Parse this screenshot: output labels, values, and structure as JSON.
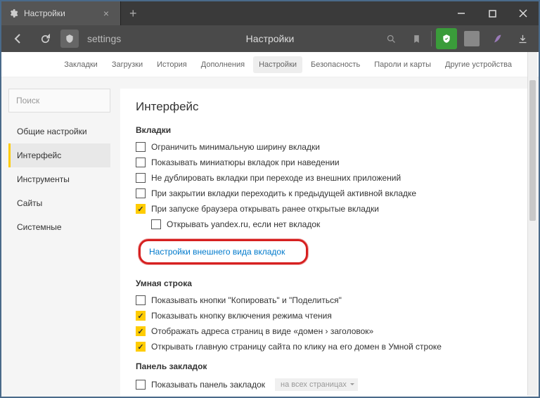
{
  "tab": {
    "title": "Настройки"
  },
  "addr": {
    "url": "settings",
    "title": "Настройки"
  },
  "topnav": {
    "items": [
      "Закладки",
      "Загрузки",
      "История",
      "Дополнения",
      "Настройки",
      "Безопасность",
      "Пароли и карты",
      "Другие устройства"
    ],
    "active": 4
  },
  "sidebar": {
    "search_placeholder": "Поиск",
    "items": [
      "Общие настройки",
      "Интерфейс",
      "Инструменты",
      "Сайты",
      "Системные"
    ],
    "active": 1
  },
  "main": {
    "title": "Интерфейс",
    "section_tabs": {
      "title": "Вкладки",
      "opts": [
        {
          "label": "Ограничить минимальную ширину вкладки",
          "checked": false
        },
        {
          "label": "Показывать миниатюры вкладок при наведении",
          "checked": false
        },
        {
          "label": "Не дублировать вкладки при переходе из внешних приложений",
          "checked": false
        },
        {
          "label": "При закрытии вкладки переходить к предыдущей активной вкладке",
          "checked": false
        },
        {
          "label": "При запуске браузера открывать ранее открытые вкладки",
          "checked": true
        },
        {
          "label": "Открывать yandex.ru, если нет вкладок",
          "checked": false,
          "indent": true
        }
      ],
      "link": "Настройки внешнего вида вкладок"
    },
    "section_smart": {
      "title": "Умная строка",
      "opts": [
        {
          "label": "Показывать кнопки \"Копировать\" и \"Поделиться\"",
          "checked": false
        },
        {
          "label": "Показывать кнопку включения режима чтения",
          "checked": true
        },
        {
          "label": "Отображать адреса страниц в виде «домен › заголовок»",
          "checked": true
        },
        {
          "label": "Открывать главную страницу сайта по клику на его домен в Умной строке",
          "checked": true
        }
      ]
    },
    "section_bm": {
      "title": "Панель закладок",
      "opt": {
        "label": "Показывать панель закладок",
        "checked": false
      },
      "dd": "на всех страницах"
    }
  }
}
